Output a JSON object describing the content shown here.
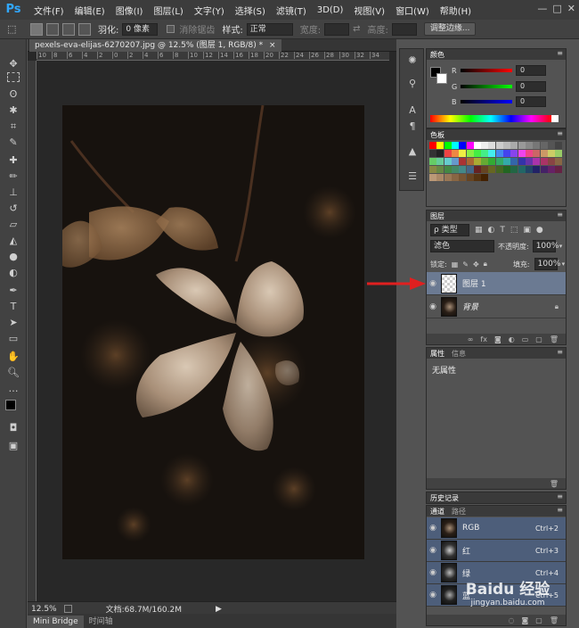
{
  "menubar": {
    "logo": "Ps",
    "items": [
      "文件(F)",
      "编辑(E)",
      "图像(I)",
      "图层(L)",
      "文字(Y)",
      "选择(S)",
      "滤镜(T)",
      "3D(D)",
      "视图(V)",
      "窗口(W)",
      "帮助(H)"
    ],
    "win_min": "—",
    "win_max": "□",
    "win_close": "✕"
  },
  "options": {
    "feather_label": "羽化:",
    "feather_value": "0 像素",
    "antialias_label": "消除锯齿",
    "style_label": "样式:",
    "style_value": "正常",
    "width_label": "宽度:",
    "height_label": "高度:",
    "refine_button": "调整边缘..."
  },
  "document": {
    "tab_title": "pexels-eva-elijas-6270207.jpg @ 12.5% (图层 1, RGB/8) *",
    "tab_close": "×",
    "ruler_ticks": [
      "10",
      "8",
      "6",
      "4",
      "2",
      "0",
      "2",
      "4",
      "6",
      "8",
      "10",
      "12",
      "14",
      "16",
      "18",
      "20",
      "22",
      "24",
      "26",
      "28",
      "30",
      "32",
      "34"
    ],
    "zoom": "12.5%",
    "doc_info": "文档:68.7M/160.2M",
    "bottom_tabs": [
      "Mini Bridge",
      "时间轴"
    ]
  },
  "color_panel": {
    "tab": "颜色",
    "r_label": "R",
    "g_label": "G",
    "b_label": "B",
    "r_value": "0",
    "g_value": "0",
    "b_value": "0"
  },
  "swatches_panel": {
    "tab": "色板"
  },
  "layers_panel": {
    "tab": "图层",
    "filter_kind": "ρ 类型",
    "blend_mode": "滤色",
    "opacity_label": "不透明度:",
    "opacity_value": "100%",
    "lock_label": "锁定:",
    "fill_label": "填充:",
    "fill_value": "100%",
    "layers": [
      {
        "name": "图层 1"
      },
      {
        "name": "背景"
      }
    ]
  },
  "properties_panel": {
    "tabs": [
      "属性",
      "信息"
    ],
    "content": "无属性"
  },
  "history_panel": {
    "tab": "历史记录"
  },
  "channels_panel": {
    "tabs": [
      "通道",
      "路径"
    ],
    "channels": [
      {
        "name": "RGB",
        "shortcut": "Ctrl+2"
      },
      {
        "name": "红",
        "shortcut": "Ctrl+3"
      },
      {
        "name": "绿",
        "shortcut": "Ctrl+4"
      },
      {
        "name": "蓝",
        "shortcut": "Ctrl+5"
      }
    ]
  },
  "watermark": {
    "brand": "Baidu 经验",
    "url": "jingyan.baidu.com"
  },
  "colors": {
    "accent_arrow": "#e02020",
    "selected_row": "#4d5e7a"
  }
}
